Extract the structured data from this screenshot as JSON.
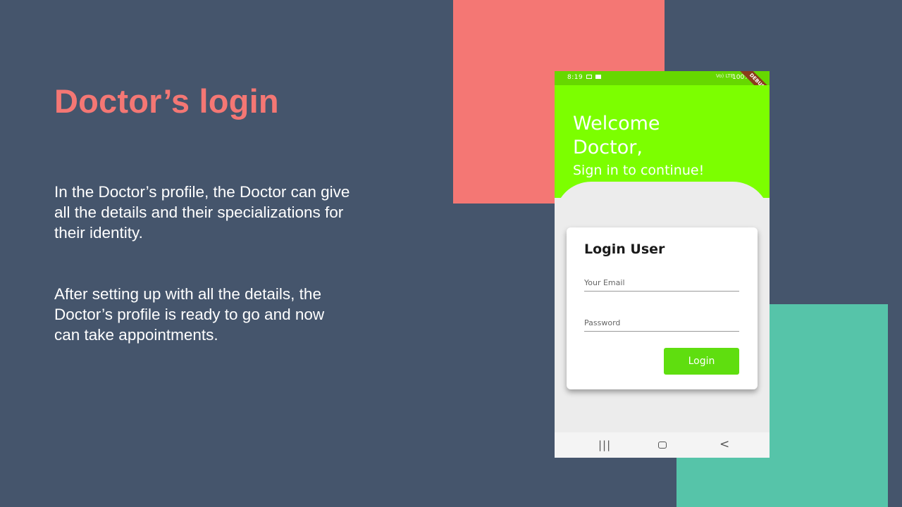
{
  "slide": {
    "title": "Doctor’s login",
    "paragraph_1": "In the Doctor’s profile, the Doctor can give all the details and their specializations for their identity.",
    "paragraph_2": "After setting up with all the details, the Doctor’s profile  is ready to go and now can take appointments."
  },
  "colors": {
    "background": "#45556c",
    "accent_coral": "#f47774",
    "accent_teal": "#56c4a9",
    "app_green": "#7cff00",
    "button_green": "#5fde0f"
  },
  "phone": {
    "status_bar": {
      "time": "8:19",
      "battery": "100%",
      "network_label": "Vo) LTE",
      "debug_banner": "DEBUG"
    },
    "header": {
      "welcome_line_1": "Welcome",
      "welcome_line_2": "Doctor,",
      "subtitle": "Sign in to continue!"
    },
    "login_card": {
      "title": "Login User",
      "email_placeholder": "Your Email",
      "password_placeholder": "Password",
      "login_button": "Login"
    },
    "nav_bar": {
      "recents_icon": "recents-icon",
      "home_icon": "home-icon",
      "back_icon": "back-icon"
    }
  }
}
